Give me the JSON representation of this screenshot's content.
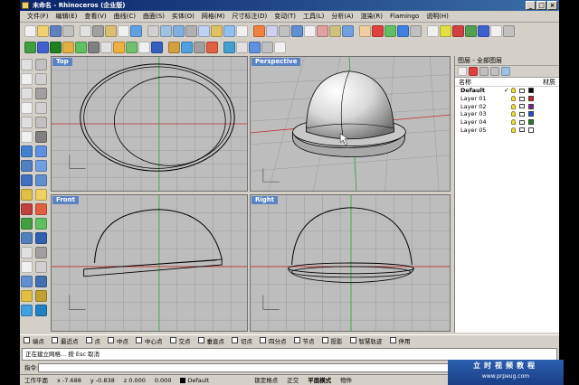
{
  "window": {
    "title": "未命名 - Rhinoceros (企业版)",
    "btn_min": "_",
    "btn_max": "□",
    "btn_close": "×"
  },
  "menu": [
    "文件(F)",
    "编辑(E)",
    "查看(V)",
    "曲线(C)",
    "曲面(S)",
    "实体(O)",
    "网格(M)",
    "尺寸标注(D)",
    "变动(T)",
    "工具(L)",
    "分析(A)",
    "渲染(R)",
    "Flamingo",
    "说明(H)"
  ],
  "toolbar_colors": {
    "row1": [
      "#f0f0f0",
      "#f0d070",
      "#6080c0",
      "#c0c0c0",
      "#e0e0e0",
      "#a0a0a0",
      "#d8c070",
      "#f0f0f0",
      "#60a0e0",
      "#d0d0d0",
      "#a0c0e0",
      "#80b0e0",
      "#b0b0b0",
      "#c0d0f0",
      "#e0c060",
      "#90c0f0",
      "#f0f0f0",
      "#f08040",
      "#d0d0f0",
      "#c0c0c0",
      "#6090d0",
      "#f0f0f0",
      "#e0a0a0",
      "#d0c080",
      "#70a0e0",
      "#f0d0a0",
      "#e04040",
      "#60c060",
      "#4080e0",
      "#c0c0c0",
      "#f0f0f0",
      "#e0e040",
      "#d04040",
      "#50a050",
      "#4060d0",
      "#f0f0f0",
      "#c0c0c0"
    ],
    "row2": [
      "#40a040",
      "#4060d0",
      "#208020",
      "#e0b040",
      "#60c060",
      "#808080",
      "#e0e0e0",
      "#f0b040",
      "#70c070",
      "#f0f0f0",
      "#3060c0",
      "#d0a040",
      "#50a0e0",
      "#a0a0a0",
      "#e06040",
      "#40a0d0",
      "#e0e0e0",
      "#6090e0",
      "#c0c0c0",
      "#f0f0f0"
    ],
    "left": [
      "#e0e0e0",
      "#c0c0c0",
      "#f0f0f0",
      "#d0d0d0",
      "#e0e0e0",
      "#a0a0a0",
      "#f0f0f0",
      "#d0d0d0",
      "#e0e0e0",
      "#c0c0c0",
      "#f0f0f0",
      "#808080",
      "#4080d0",
      "#6090e0",
      "#5080c0",
      "#70a0e0",
      "#4070c0",
      "#6090d0",
      "#e0c040",
      "#f0d060",
      "#c04040",
      "#e06040",
      "#40a040",
      "#60c060",
      "#5080c0",
      "#3060b0",
      "#e0e0e0",
      "#a0a0a0",
      "#f0f0f0",
      "#d0d0d0",
      "#6090d0",
      "#4070b0",
      "#e0c040",
      "#c0a030",
      "#40a0e0",
      "#2080c0"
    ]
  },
  "viewports": {
    "top": "Top",
    "perspective": "Perspective",
    "front": "Front",
    "right": "Right"
  },
  "layers_panel": {
    "header": "图层 - 全部图层",
    "col_name": "名称",
    "col_material": "材质",
    "rows": [
      {
        "name": "Default",
        "current": "✓",
        "color": "#000000",
        "bold": true
      },
      {
        "name": "Layer 01",
        "current": "",
        "color": "#d02020"
      },
      {
        "name": "Layer 02",
        "current": "",
        "color": "#8020a0"
      },
      {
        "name": "Layer 03",
        "current": "",
        "color": "#2050d0"
      },
      {
        "name": "Layer 04",
        "current": "",
        "color": "#208020"
      },
      {
        "name": "Layer 05",
        "current": "",
        "color": "#ffffff"
      }
    ]
  },
  "osnap": [
    "端点",
    "最近点",
    "点",
    "中点",
    "中心点",
    "交点",
    "垂直点",
    "切点",
    "四分点",
    "节点",
    "投影",
    "智慧轨迹",
    "停用"
  ],
  "command": {
    "history": "正在建立网格... 按 Esc 取消",
    "prompt": "指令:"
  },
  "status": {
    "cplane": "工作平面",
    "x": "x -7.688",
    "y": "y -0.838",
    "z": "z 0.000",
    "d": "0.000",
    "layer": "Default",
    "snap": "锁定格点",
    "ortho": "正交",
    "planar": "平面模式",
    "osnap": "物件"
  },
  "watermark": {
    "line1": "立时视频教程",
    "line2": "www.prpeug.com"
  }
}
